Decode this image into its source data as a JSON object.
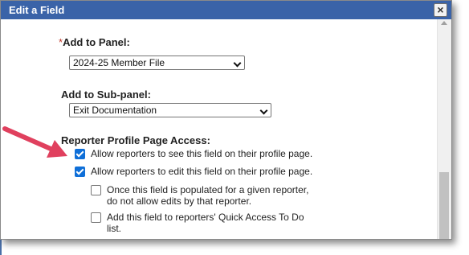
{
  "dialog": {
    "title": "Edit a Field",
    "close_glyph": "×"
  },
  "form": {
    "panel": {
      "required_mark": "*",
      "label": "Add to Panel:",
      "selected": "2024-25 Member File"
    },
    "subpanel": {
      "label": "Add to Sub-panel:",
      "selected": "Exit Documentation"
    },
    "access": {
      "label": "Reporter Profile Page Access:",
      "options": [
        {
          "text": "Allow reporters to see this field on their profile page.",
          "checked": true
        },
        {
          "text": "Allow reporters to edit this field on their profile page.",
          "checked": true
        },
        {
          "text_line1": "Once this field is populated for a given reporter,",
          "text_line2": "do not allow edits by that reporter.",
          "checked": false
        },
        {
          "text_line1": "Add this field to reporters' Quick Access To Do",
          "text_line2": "list.",
          "checked": false
        }
      ]
    }
  },
  "colors": {
    "titlebar": "#3a63a8",
    "checkbox_checked": "#0f6fd8",
    "annotation_arrow": "#e0405e"
  },
  "icons": {
    "close": "close-icon",
    "annotation": "red-arrow-icon"
  }
}
